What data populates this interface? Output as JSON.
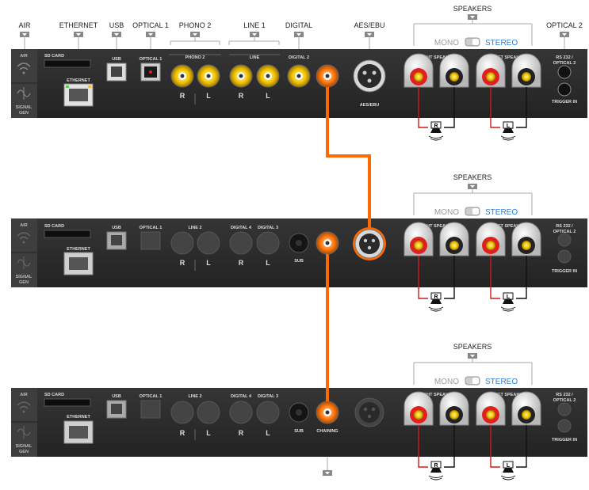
{
  "top_labels": {
    "air": "AIR",
    "ethernet": "ETHERNET",
    "usb": "USB",
    "optical1": "OPTICAL 1",
    "phono2": "PHONO 2",
    "line1": "LINE 1",
    "digital": "DIGITAL",
    "aes_ebu": "AES/EBU",
    "optical2": "OPTICAL 2"
  },
  "speakers_label": "SPEAKERS",
  "mode": {
    "mono": "MONO",
    "stereo": "STEREO"
  },
  "side": {
    "air": "AIR",
    "signal": "SIGNAL",
    "gen": "GEN"
  },
  "panel1": {
    "sd_card": "SD CARD",
    "ethernet": "ETHERNET",
    "usb": "USB",
    "optical1": "OPTICAL 1",
    "phono2": "PHONO 2",
    "line": "LINE",
    "digital2": "DIGITAL 2",
    "aes_ebu": "AES/EBU",
    "right_speaker": "RIGHT SPEAKER",
    "left_speaker": "LEFT SPEAKER",
    "rs232_a": "RS 232 /",
    "rs232_b": "OPTICAL 2",
    "trigger_in": "TRIGGER IN",
    "r": "R",
    "l": "L"
  },
  "panel2": {
    "sd_card": "SD CARD",
    "ethernet": "ETHERNET",
    "usb": "USB",
    "optical1": "OPTICAL 1",
    "line2": "LINE 2",
    "digital4": "DIGITAL 4",
    "digital3": "DIGITAL 3",
    "sub": "SUB",
    "right_speaker": "RIGHT SPEAKER",
    "left_speaker": "LEFT SPEAKER",
    "rs232_a": "RS 232 /",
    "rs232_b": "OPTICAL 2",
    "trigger_in": "TRIGGER IN",
    "r": "R",
    "l": "L"
  },
  "panel3": {
    "sd_card": "SD CARD",
    "ethernet": "ETHERNET",
    "usb": "USB",
    "optical1": "OPTICAL 1",
    "line2": "LINE 2",
    "digital4": "DIGITAL 4",
    "digital3": "DIGITAL 3",
    "sub": "SUB",
    "chaining": "CHAINING",
    "right_speaker": "RIGHT SPEAKER",
    "left_speaker": "LEFT SPEAKER",
    "rs232_a": "RS 232 /",
    "rs232_b": "OPTICAL 2",
    "trigger_in": "TRIGGER IN",
    "r": "R",
    "l": "L"
  },
  "speaker_badges": {
    "right": "R",
    "left": "L"
  },
  "colors": {
    "panel": "#2b2b2b",
    "cable": "#ff6a00",
    "stereo": "#2a7fd4",
    "wire_red": "#d01818"
  }
}
